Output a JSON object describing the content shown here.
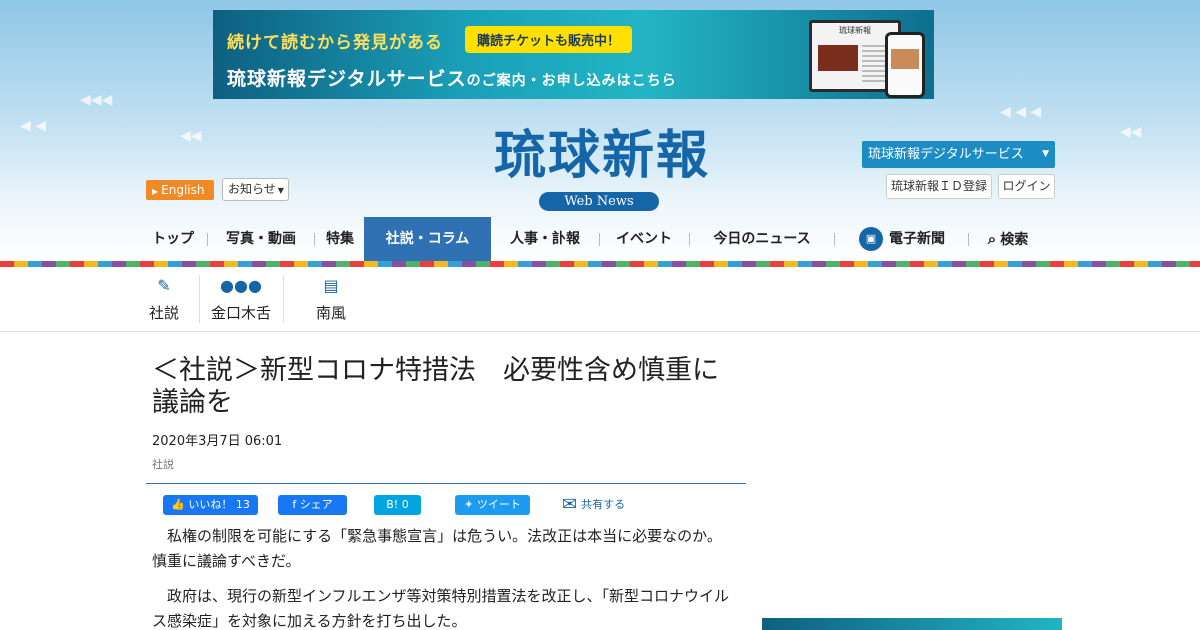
{
  "banner": {
    "line1": "続けて読むから発見がある",
    "badge": "購読チケットも販売中！",
    "line2": "琉球新報デジタルサービス",
    "line2_suffix": "のご案内・お申し込みはこちら",
    "device_title": "琉球新報"
  },
  "header": {
    "logo": "琉球新報",
    "logo_sub": "Web News",
    "english": "English",
    "oshirase": "お知らせ",
    "digital_service": "琉球新報デジタルサービス",
    "id_register": "琉球新報ＩＤ登録",
    "login": "ログイン"
  },
  "nav": {
    "items": [
      "トップ",
      "写真・動画",
      "特集",
      "社説・コラム",
      "人事・訃報",
      "イベント",
      "今日のニュース",
      "電子新聞",
      "検索"
    ],
    "active": "社説・コラム"
  },
  "subnav": {
    "items": [
      {
        "label": "社説",
        "icon": "pen-icon"
      },
      {
        "label": "金口木舌",
        "icon": "speech-bubble-icon"
      },
      {
        "label": "南風",
        "icon": "message-icon"
      }
    ]
  },
  "article": {
    "headline": "＜社説＞新型コロナ特措法　必要性含め慎重に議論を",
    "date": "2020年3月7日 06:01",
    "category": "社説",
    "paragraphs": [
      "私権の制限を可能にする「緊急事態宣言」は危うい。法改正は本当に必要なのか。慎重に議論すべきだ。",
      "政府は、現行の新型インフルエンザ等対策特別措置法を改正し、「新型コロナウイルス感染症」を対象に加える方針を打ち出した。"
    ]
  },
  "share": {
    "fb_like": "いいね！ 13",
    "fb_share": "シェア",
    "hatena": "B! 0",
    "twitter": "ツイート",
    "share_all": "共有する"
  },
  "colors": {
    "brand": "#1566a8",
    "nav_active": "#2f71b2",
    "english_button": "#f08a24",
    "banner_badge": "#ffe000"
  }
}
